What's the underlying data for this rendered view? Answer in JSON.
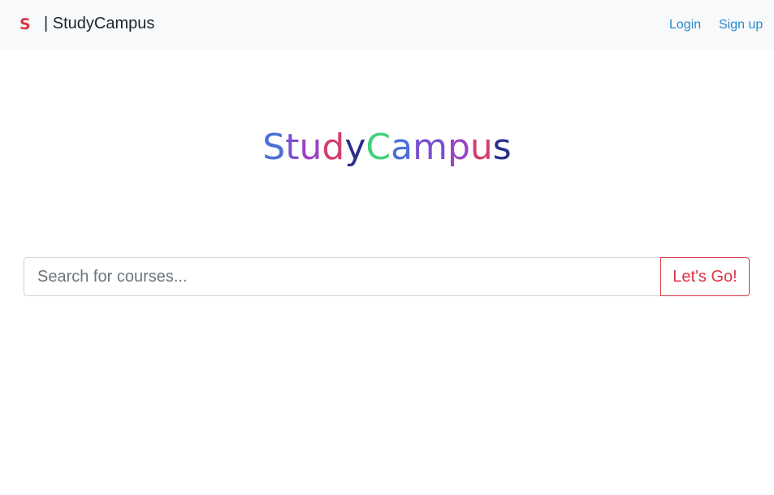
{
  "navbar": {
    "logo_letter": "S",
    "brand_text": "| StudyCampus",
    "links": [
      {
        "label": "Login"
      },
      {
        "label": "Sign up"
      }
    ]
  },
  "hero": {
    "letters": [
      {
        "char": "S",
        "color": "#4b6fd6"
      },
      {
        "char": "t",
        "color": "#7a4fcf"
      },
      {
        "char": "u",
        "color": "#9b42c7"
      },
      {
        "char": "d",
        "color": "#d23f6d"
      },
      {
        "char": "y",
        "color": "#2a2f8c"
      },
      {
        "char": "C",
        "color": "#3fd27a"
      },
      {
        "char": "a",
        "color": "#4b6fd6"
      },
      {
        "char": "m",
        "color": "#7a4fcf"
      },
      {
        "char": "p",
        "color": "#9b42c7"
      },
      {
        "char": "u",
        "color": "#d23f6d"
      },
      {
        "char": "s",
        "color": "#2a2f8c"
      }
    ]
  },
  "search": {
    "placeholder": "Search for courses...",
    "value": "",
    "button_label": "Let's Go!"
  },
  "colors": {
    "link": "#2a8ad0",
    "accent": "#dc3545",
    "navbar_bg": "#f8f9fa"
  }
}
